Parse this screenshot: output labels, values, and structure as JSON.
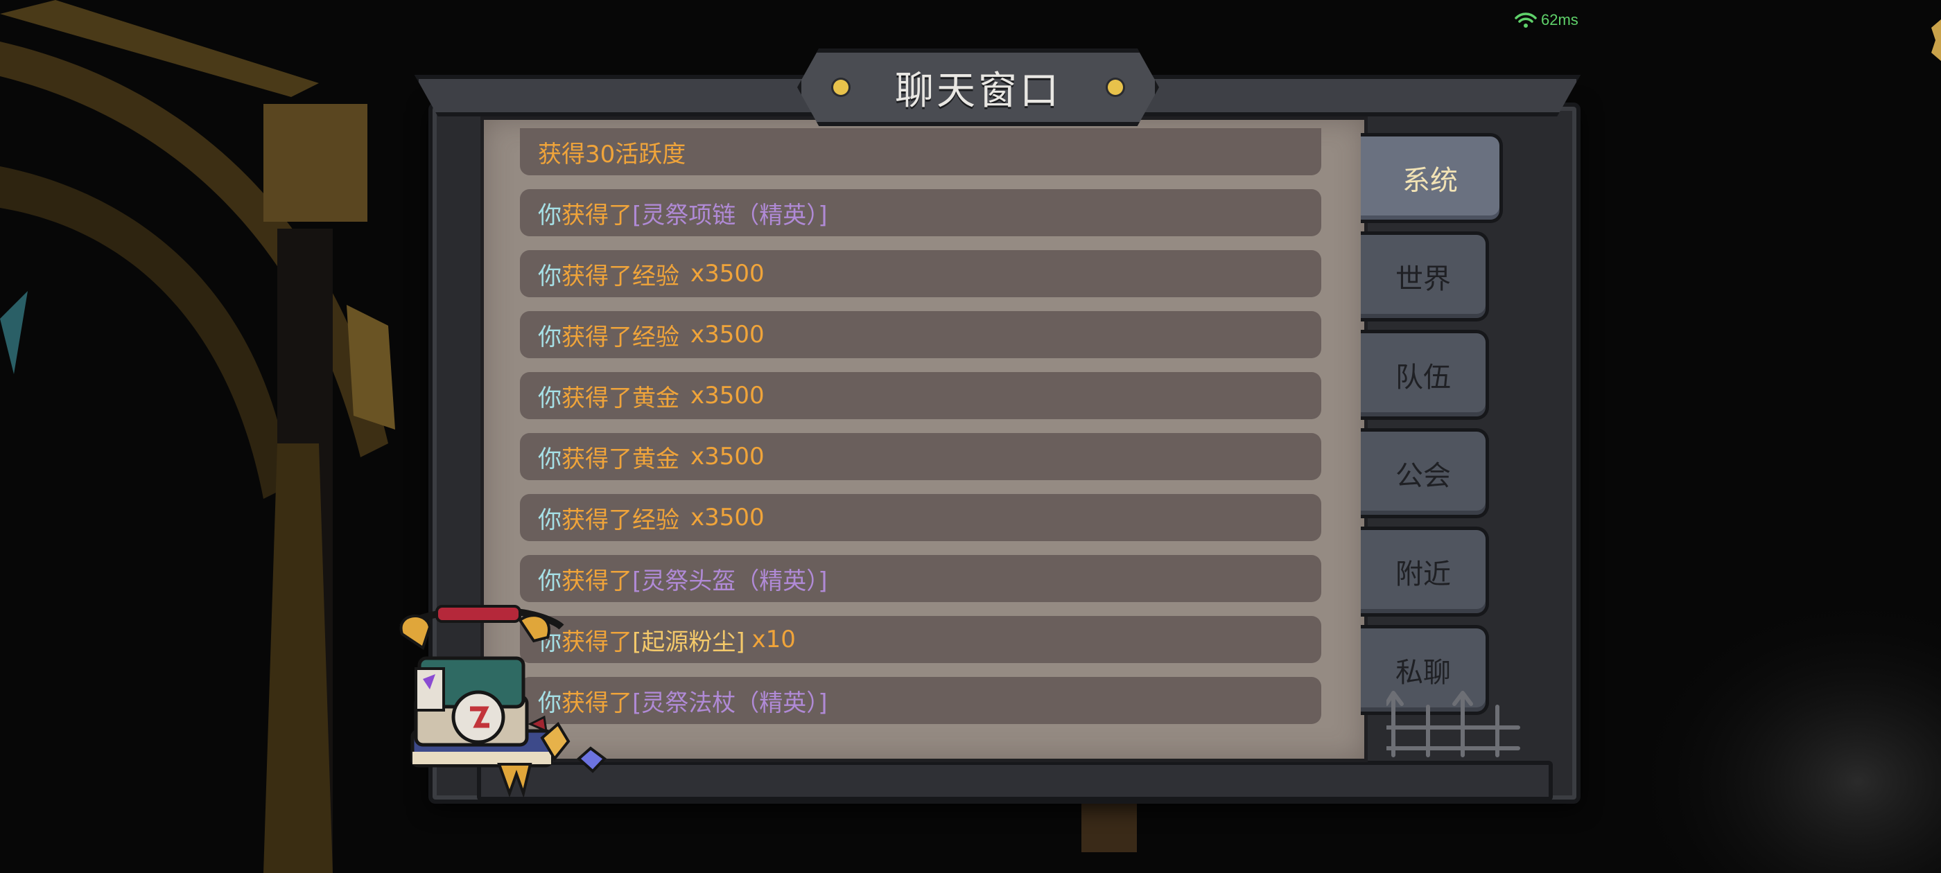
{
  "status": {
    "ping": "62ms"
  },
  "window": {
    "title": "聊天窗口"
  },
  "messages": [
    {
      "text": "获得30活跃度"
    },
    {
      "you": "你",
      "verb": "获得了",
      "item": "[灵祭项链（精英）]"
    },
    {
      "you": "你",
      "verb": "获得了经验",
      "qty": "x3500"
    },
    {
      "you": "你",
      "verb": "获得了经验",
      "qty": "x3500"
    },
    {
      "you": "你",
      "verb": "获得了黄金",
      "qty": "x3500"
    },
    {
      "you": "你",
      "verb": "获得了黄金",
      "qty": "x3500"
    },
    {
      "you": "你",
      "verb": "获得了经验",
      "qty": "x3500"
    },
    {
      "you": "你",
      "verb": "获得了",
      "item": "[灵祭头盔（精英）]"
    },
    {
      "you": "你",
      "verb": "获得了",
      "item": "[起源粉尘]",
      "qty": "x10"
    },
    {
      "you": "你",
      "verb": "获得了",
      "item": "[灵祭法杖（精英）]"
    }
  ],
  "tabs": [
    {
      "label": "系统",
      "active": true
    },
    {
      "label": "世界",
      "active": false
    },
    {
      "label": "队伍",
      "active": false
    },
    {
      "label": "公会",
      "active": false
    },
    {
      "label": "附近",
      "active": false
    },
    {
      "label": "私聊",
      "active": false
    }
  ],
  "colors": {
    "you": "#a6e0e6",
    "gain": "#f0a43a",
    "item_elite": "#b08ad6",
    "item_rare": "#f4c96a",
    "active_tab_text": "#f2e3b5"
  },
  "icons": {
    "network": "wifi-icon",
    "mascot": "telephone-chest-mascot-icon",
    "title_dots": "gold-dot-icon"
  }
}
